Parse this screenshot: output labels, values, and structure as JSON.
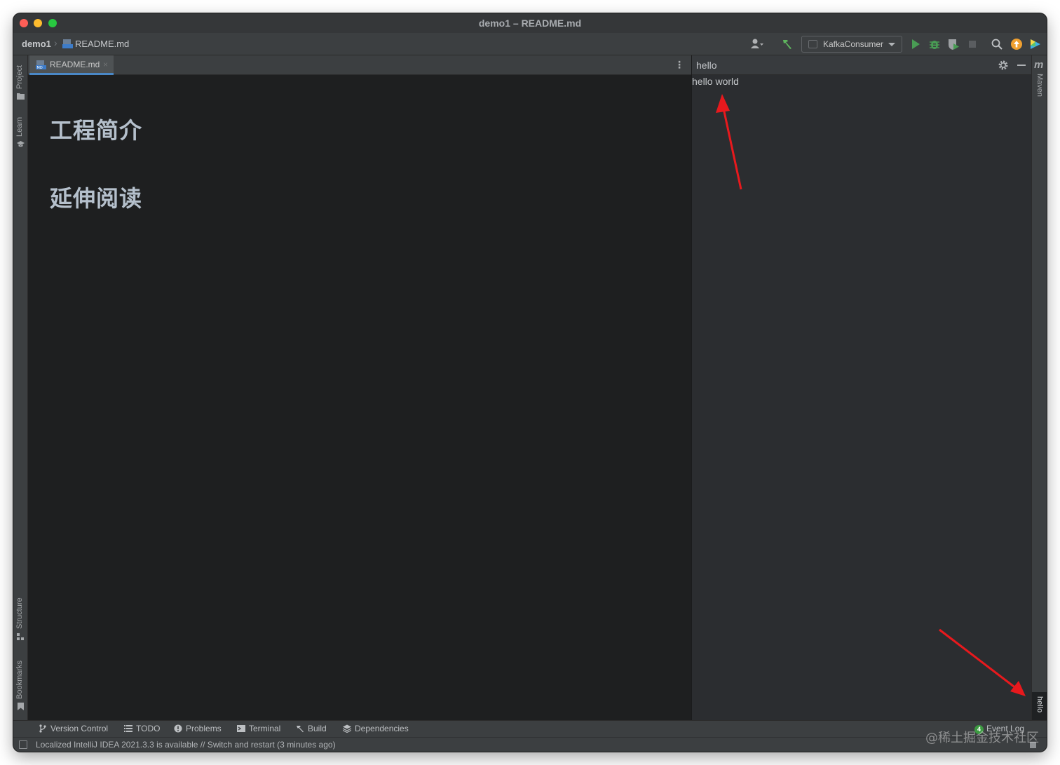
{
  "window": {
    "title": "demo1 – README.md"
  },
  "navbar": {
    "project": "demo1",
    "file": "README.md",
    "run_config": "KafkaConsumer"
  },
  "left_strip": {
    "top_tabs": [
      "Project",
      "Learn"
    ],
    "bottom_tabs": [
      "Structure",
      "Bookmarks"
    ]
  },
  "right_strip": {
    "top_tab": "Maven",
    "top_tab_glyph": "m",
    "bottom_tab": "hello"
  },
  "editor": {
    "tab_label": "README.md",
    "tab_icon_text": "MD",
    "headings": [
      "工程简介",
      "延伸阅读"
    ]
  },
  "tool_window": {
    "title": "hello",
    "content": "hello world"
  },
  "bottom_tabs": {
    "items": [
      "Version Control",
      "TODO",
      "Problems",
      "Terminal",
      "Build",
      "Dependencies"
    ],
    "event_log_label": "Event Log",
    "event_log_count": "4"
  },
  "status_bar": {
    "message": "Localized IntelliJ IDEA 2021.3.3 is available // Switch and restart (3 minutes ago)"
  },
  "watermark": "@稀土掘金技术社区",
  "colors": {
    "accent_tab_underline": "#4a88c7",
    "annotation_arrow": "#e8191d",
    "run_green": "#3c9a41",
    "update_orange": "#f0a030"
  }
}
